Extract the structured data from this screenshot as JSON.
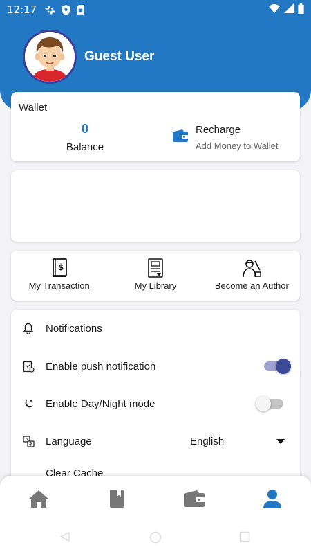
{
  "status_bar": {
    "time": "12:17",
    "icons": [
      "settings-gear-icon",
      "shield-icon",
      "sim-card-icon",
      "wifi-icon",
      "signal-icon",
      "battery-icon"
    ]
  },
  "colors": {
    "primary": "#2278c2",
    "toggle_on": "#3b4a97",
    "background": "#f3f3f5"
  },
  "profile": {
    "name": "Guest User"
  },
  "wallet": {
    "title": "Wallet",
    "balance_value": "0",
    "balance_label": "Balance",
    "recharge_title": "Recharge",
    "recharge_subtitle": "Add Money to Wallet"
  },
  "quick_actions": [
    {
      "label": "My Transaction",
      "icon": "transaction-book-icon"
    },
    {
      "label": "My Library",
      "icon": "library-icon"
    },
    {
      "label": "Become an Author",
      "icon": "author-icon"
    }
  ],
  "settings": {
    "notifications_label": "Notifications",
    "push_label": "Enable push notification",
    "push_enabled": true,
    "daynight_label": "Enable Day/Night mode",
    "daynight_enabled": false,
    "language_label": "Language",
    "language_value": "English",
    "clear_cache_label": "Clear Cache"
  },
  "bottom_nav": {
    "items": [
      "home-icon",
      "book-icon",
      "wallet-icon",
      "profile-icon"
    ],
    "active": "profile-icon"
  }
}
